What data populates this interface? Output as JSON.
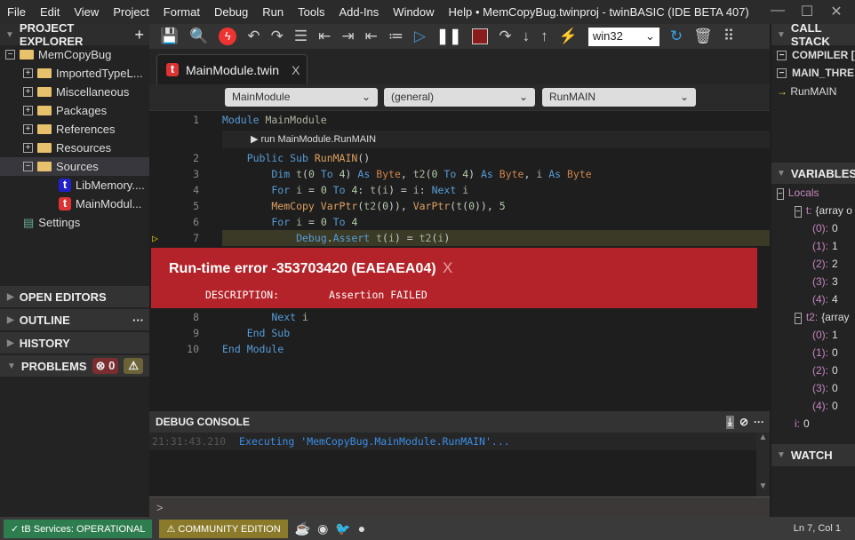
{
  "menu": [
    "File",
    "Edit",
    "View",
    "Project",
    "Format",
    "Debug",
    "Run",
    "Tools",
    "Add-Ins",
    "Window",
    "Help"
  ],
  "window_title": "• MemCopyBug.twinproj - twinBASIC (IDE BETA 407)",
  "explorer": {
    "title": "PROJECT EXPLORER",
    "items": [
      {
        "label": "MemCopyBug",
        "kind": "folder",
        "toggle": "−",
        "level": 0
      },
      {
        "label": "ImportedTypeL...",
        "kind": "folder",
        "toggle": "+",
        "level": 1
      },
      {
        "label": "Miscellaneous",
        "kind": "folder",
        "toggle": "+",
        "level": 1
      },
      {
        "label": "Packages",
        "kind": "folder",
        "toggle": "+",
        "level": 1
      },
      {
        "label": "References",
        "kind": "folder",
        "toggle": "+",
        "level": 1
      },
      {
        "label": "Resources",
        "kind": "folder",
        "toggle": "+",
        "level": 1
      },
      {
        "label": "Sources",
        "kind": "folder",
        "toggle": "−",
        "level": 1,
        "selected": true
      },
      {
        "label": "LibMemory....",
        "kind": "file-blue",
        "level": 2
      },
      {
        "label": "MainModul...",
        "kind": "file-red",
        "level": 2
      },
      {
        "label": "Settings",
        "kind": "settings",
        "level": 1
      }
    ]
  },
  "sections": {
    "open_editors": "OPEN EDITORS",
    "outline": "OUTLINE",
    "history": "HISTORY",
    "problems": "PROBLEMS",
    "errors": "0",
    "more": "···"
  },
  "toolbar": {
    "platform": "win32"
  },
  "tab": {
    "label": "MainModule.twin",
    "close": "X",
    "icon": "t"
  },
  "dropdowns": {
    "module": "MainModule",
    "scope": "(general)",
    "proc": "RunMAIN"
  },
  "codelens": "run MainModule.RunMAIN",
  "code": {
    "current_line": 7,
    "lines": [
      {
        "n": "1",
        "t": [
          [
            "kw",
            "Module "
          ],
          [
            "mo",
            "MainModule"
          ]
        ]
      },
      {
        "n": "2",
        "t": [
          [
            "kw",
            "    Public Sub "
          ],
          [
            "fn",
            "RunMAIN"
          ],
          [
            "pu",
            "()"
          ]
        ]
      },
      {
        "n": "3",
        "t": [
          [
            "kw",
            "        Dim "
          ],
          [
            "id",
            "t"
          ],
          [
            "pu",
            "("
          ],
          [
            "num",
            "0"
          ],
          [
            "kw",
            " To "
          ],
          [
            "num",
            "4"
          ],
          [
            "pu",
            ") "
          ],
          [
            "kw",
            "As "
          ],
          [
            "ty",
            "Byte"
          ],
          [
            "pu",
            ", "
          ],
          [
            "id",
            "t2"
          ],
          [
            "pu",
            "("
          ],
          [
            "num",
            "0"
          ],
          [
            "kw",
            " To "
          ],
          [
            "num",
            "4"
          ],
          [
            "pu",
            ") "
          ],
          [
            "kw",
            "As "
          ],
          [
            "ty",
            "Byte"
          ],
          [
            "pu",
            ", "
          ],
          [
            "id",
            "i "
          ],
          [
            "kw",
            "As "
          ],
          [
            "ty",
            "Byte"
          ]
        ]
      },
      {
        "n": "4",
        "t": [
          [
            "kw",
            "        For "
          ],
          [
            "id",
            "i"
          ],
          [
            "pu",
            " = "
          ],
          [
            "num",
            "0"
          ],
          [
            "kw",
            " To "
          ],
          [
            "num",
            "4"
          ],
          [
            "pu",
            ": "
          ],
          [
            "id",
            "t"
          ],
          [
            "pu",
            "("
          ],
          [
            "id",
            "i"
          ],
          [
            "pu",
            ") = "
          ],
          [
            "id",
            "i"
          ],
          [
            "pu",
            ": "
          ],
          [
            "kw",
            "Next "
          ],
          [
            "id",
            "i"
          ]
        ]
      },
      {
        "n": "5",
        "t": [
          [
            "fn",
            "        MemCopy "
          ],
          [
            "fn",
            "VarPtr"
          ],
          [
            "pu",
            "("
          ],
          [
            "id",
            "t2"
          ],
          [
            "pu",
            "("
          ],
          [
            "num",
            "0"
          ],
          [
            "pu",
            ")), "
          ],
          [
            "fn",
            "VarPtr"
          ],
          [
            "pu",
            "("
          ],
          [
            "id",
            "t"
          ],
          [
            "pu",
            "("
          ],
          [
            "num",
            "0"
          ],
          [
            "pu",
            ")), "
          ],
          [
            "num",
            "5"
          ]
        ]
      },
      {
        "n": "6",
        "t": [
          [
            "kw",
            "        For "
          ],
          [
            "id",
            "i"
          ],
          [
            "pu",
            " = "
          ],
          [
            "num",
            "0"
          ],
          [
            "kw",
            " To "
          ],
          [
            "num",
            "4"
          ]
        ]
      },
      {
        "n": "7",
        "t": [
          [
            "kw",
            "            Debug"
          ],
          [
            "pu",
            "."
          ],
          [
            "kw",
            "Assert "
          ],
          [
            "id",
            "t"
          ],
          [
            "pu",
            "("
          ],
          [
            "id",
            "i"
          ],
          [
            "pu",
            ") = "
          ],
          [
            "id",
            "t2"
          ],
          [
            "pu",
            "("
          ],
          [
            "id",
            "i"
          ],
          [
            "pu",
            ")"
          ]
        ]
      },
      {
        "n": "8",
        "t": [
          [
            "kw",
            "        Next "
          ],
          [
            "id",
            "i"
          ]
        ]
      },
      {
        "n": "9",
        "t": [
          [
            "kw",
            "    End Sub"
          ]
        ]
      },
      {
        "n": "10",
        "t": [
          [
            "kw",
            "End Module"
          ]
        ]
      }
    ]
  },
  "error": {
    "title": "Run-time error -353703420 (EAEAEA04)",
    "close": "X",
    "desc_label": "DESCRIPTION:",
    "desc": "Assertion FAILED"
  },
  "debug_console": {
    "title": "DEBUG CONSOLE",
    "time": "21:31:43.210",
    "message": "Executing 'MemCopyBug.MainModule.RunMAIN'...",
    "prompt": ">"
  },
  "call_stack": {
    "title": "CALL STACK",
    "items": [
      "COMPILER [",
      "MAIN_THRE",
      "RunMAIN"
    ]
  },
  "variables": {
    "title": "VARIABLES",
    "locals": "Locals",
    "t": {
      "name": "t:",
      "type": "{array o",
      "items": [
        [
          "(0):",
          "0"
        ],
        [
          "(1):",
          "1"
        ],
        [
          "(2):",
          "2"
        ],
        [
          "(3):",
          "3"
        ],
        [
          "(4):",
          "4"
        ]
      ]
    },
    "t2": {
      "name": "t2:",
      "type": "{array",
      "items": [
        [
          "(0):",
          "1"
        ],
        [
          "(1):",
          "0"
        ],
        [
          "(2):",
          "0"
        ],
        [
          "(3):",
          "0"
        ],
        [
          "(4):",
          "0"
        ]
      ]
    },
    "i": {
      "name": "i:",
      "value": "0"
    }
  },
  "watch": {
    "title": "WATCH"
  },
  "status": {
    "services": "tB Services: OPERATIONAL",
    "edition": "COMMUNITY EDITION",
    "position": "Ln 7, Col 1"
  },
  "colors": {
    "error": "#b5232a",
    "services": "#2e7d4f",
    "edition": "#8a7a2a",
    "current_line": "#3a3a26"
  }
}
